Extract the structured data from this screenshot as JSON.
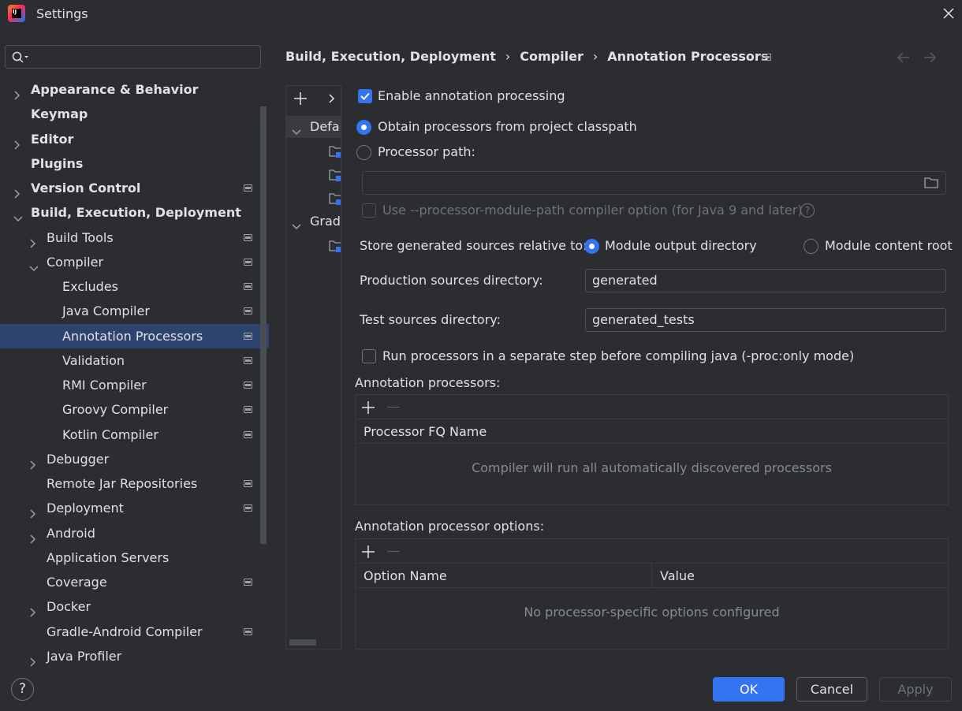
{
  "window": {
    "title": "Settings",
    "app_icon_text": "IJ"
  },
  "sidebar": {
    "search_placeholder": "",
    "items": [
      {
        "label": "Appearance & Behavior",
        "level": 0,
        "expandable": true,
        "expanded": false,
        "bold": true,
        "pinned": false
      },
      {
        "label": "Keymap",
        "level": 0,
        "expandable": false,
        "bold": true,
        "pinned": false
      },
      {
        "label": "Editor",
        "level": 0,
        "expandable": true,
        "expanded": false,
        "bold": true,
        "pinned": false
      },
      {
        "label": "Plugins",
        "level": 0,
        "expandable": false,
        "bold": true,
        "pinned": false
      },
      {
        "label": "Version Control",
        "level": 0,
        "expandable": true,
        "expanded": false,
        "bold": true,
        "pinned": true
      },
      {
        "label": "Build, Execution, Deployment",
        "level": 0,
        "expandable": true,
        "expanded": true,
        "bold": true,
        "pinned": false
      },
      {
        "label": "Build Tools",
        "level": 1,
        "expandable": true,
        "expanded": false,
        "pinned": true
      },
      {
        "label": "Compiler",
        "level": 1,
        "expandable": true,
        "expanded": true,
        "pinned": true
      },
      {
        "label": "Excludes",
        "level": 2,
        "expandable": false,
        "pinned": true
      },
      {
        "label": "Java Compiler",
        "level": 2,
        "expandable": false,
        "pinned": true
      },
      {
        "label": "Annotation Processors",
        "level": 2,
        "expandable": false,
        "pinned": true,
        "selected": true
      },
      {
        "label": "Validation",
        "level": 2,
        "expandable": false,
        "pinned": true
      },
      {
        "label": "RMI Compiler",
        "level": 2,
        "expandable": false,
        "pinned": true
      },
      {
        "label": "Groovy Compiler",
        "level": 2,
        "expandable": false,
        "pinned": true
      },
      {
        "label": "Kotlin Compiler",
        "level": 2,
        "expandable": false,
        "pinned": true
      },
      {
        "label": "Debugger",
        "level": 1,
        "expandable": true,
        "expanded": false,
        "pinned": false
      },
      {
        "label": "Remote Jar Repositories",
        "level": 1,
        "expandable": false,
        "pinned": true
      },
      {
        "label": "Deployment",
        "level": 1,
        "expandable": true,
        "expanded": false,
        "pinned": true
      },
      {
        "label": "Android",
        "level": 1,
        "expandable": true,
        "expanded": false,
        "pinned": false
      },
      {
        "label": "Application Servers",
        "level": 1,
        "expandable": false,
        "pinned": false
      },
      {
        "label": "Coverage",
        "level": 1,
        "expandable": false,
        "pinned": true
      },
      {
        "label": "Docker",
        "level": 1,
        "expandable": true,
        "expanded": false,
        "pinned": false
      },
      {
        "label": "Gradle-Android Compiler",
        "level": 1,
        "expandable": false,
        "pinned": true
      },
      {
        "label": "Java Profiler",
        "level": 1,
        "expandable": true,
        "expanded": false,
        "pinned": false
      }
    ]
  },
  "breadcrumb": [
    "Build, Execution, Deployment",
    "Compiler",
    "Annotation Processors"
  ],
  "profiles_tree": {
    "rows": [
      {
        "label": "Default",
        "type": "group",
        "expanded": true,
        "selected": true
      },
      {
        "label": "",
        "type": "module"
      },
      {
        "label": "",
        "type": "module"
      },
      {
        "label": "",
        "type": "module"
      },
      {
        "label": "Gradle Imported",
        "type": "group",
        "expanded": true
      },
      {
        "label": "",
        "type": "module"
      }
    ]
  },
  "form": {
    "enable_label": "Enable annotation processing",
    "enable_checked": true,
    "obtain_label": "Obtain processors from project classpath",
    "processor_path_label": "Processor path:",
    "processor_path_value": "",
    "module_path_label": "Use --processor-module-path compiler option (for Java 9 and later)",
    "store_label": "Store generated sources relative to:",
    "module_output_label": "Module output directory",
    "module_content_label": "Module content root",
    "production_label": "Production sources directory:",
    "production_value": "generated",
    "test_label": "Test sources directory:",
    "test_value": "generated_tests",
    "separate_step_label": "Run processors in a separate step before compiling java (-proc:only mode)"
  },
  "processors_table": {
    "title": "Annotation processors:",
    "column": "Processor FQ Name",
    "empty_text": "Compiler will run all automatically discovered processors"
  },
  "options_table": {
    "title": "Annotation processor options:",
    "columns": [
      "Option Name",
      "Value"
    ],
    "empty_text": "No processor-specific options configured"
  },
  "footer": {
    "help": "?",
    "ok": "OK",
    "cancel": "Cancel",
    "apply": "Apply"
  },
  "colors": {
    "accent": "#3574f0",
    "selection": "#2e436e",
    "background": "#2b2d30"
  }
}
